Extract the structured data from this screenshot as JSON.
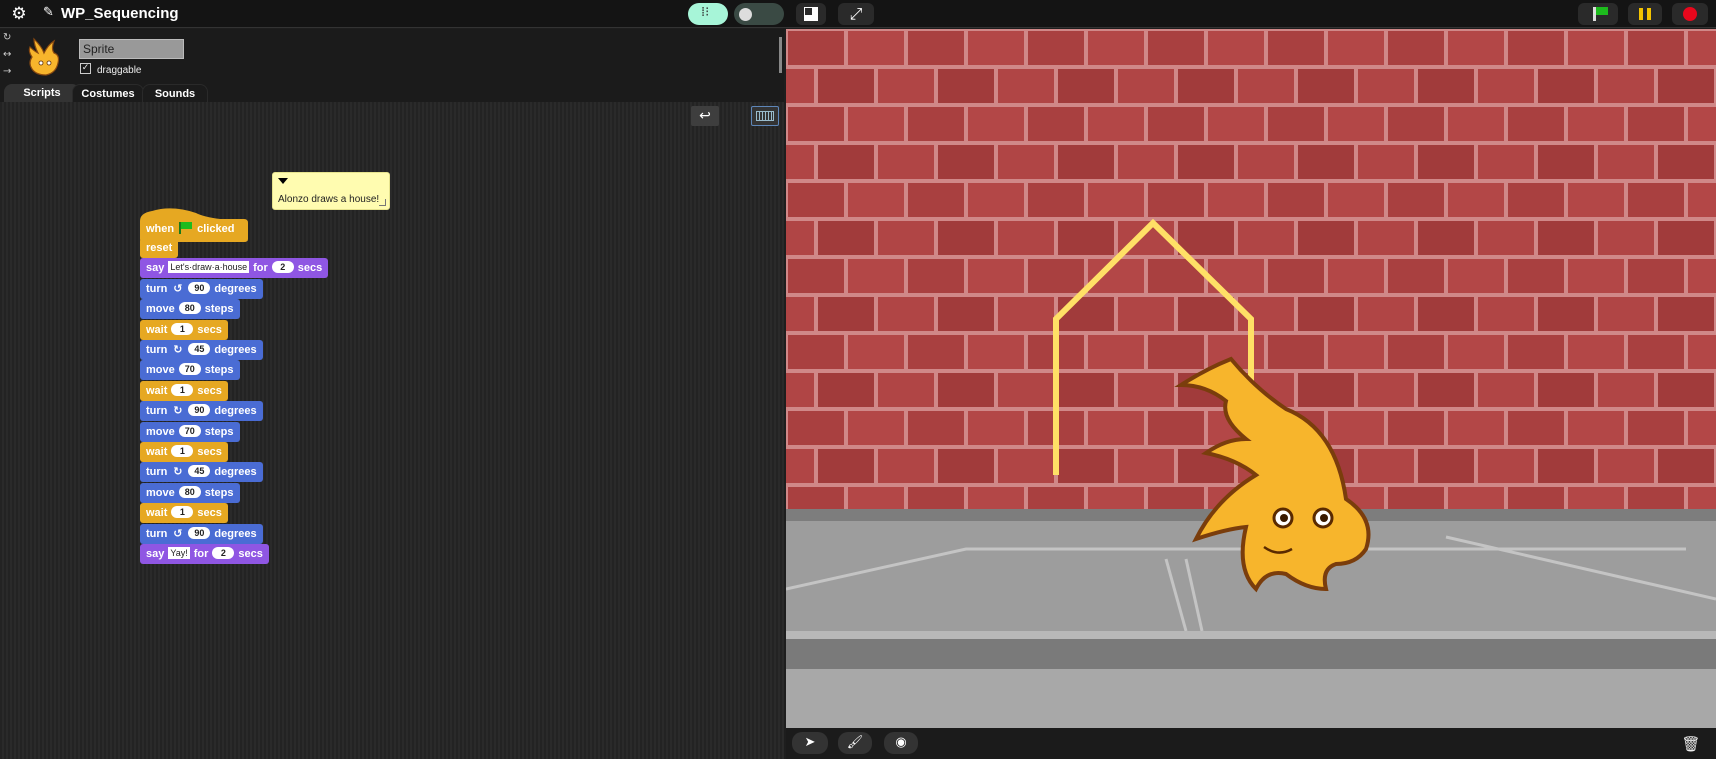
{
  "project": {
    "title": "WP_Sequencing"
  },
  "toolbar": {
    "settings_icon": "gear-icon",
    "stepping_icon": "footprints-icon",
    "fullscreen_icon": "expand-icon"
  },
  "sprite": {
    "name": "Sprite",
    "draggable_label": "draggable",
    "draggable_checked": "✓"
  },
  "tabs": [
    {
      "label": "Scripts",
      "active": true
    },
    {
      "label": "Costumes",
      "active": false
    },
    {
      "label": "Sounds",
      "active": false
    }
  ],
  "comment": {
    "text": "Alonzo draws a house!"
  },
  "script": {
    "hat": {
      "when": "when",
      "clicked": "clicked"
    },
    "blocks": [
      {
        "kind": "control",
        "label": "reset"
      },
      {
        "kind": "looks",
        "say": "say",
        "message": "Let's·draw·a·house",
        "for": "for",
        "secs_value": "2",
        "secs": "secs"
      },
      {
        "kind": "motion",
        "turn": "turn",
        "direction": "ccw",
        "value": "90",
        "unit": "degrees"
      },
      {
        "kind": "motion",
        "move": "move",
        "value": "80",
        "unit": "steps"
      },
      {
        "kind": "control",
        "wait": "wait",
        "value": "1",
        "unit": "secs"
      },
      {
        "kind": "motion",
        "turn": "turn",
        "direction": "cw",
        "value": "45",
        "unit": "degrees"
      },
      {
        "kind": "motion",
        "move": "move",
        "value": "70",
        "unit": "steps"
      },
      {
        "kind": "control",
        "wait": "wait",
        "value": "1",
        "unit": "secs"
      },
      {
        "kind": "motion",
        "turn": "turn",
        "direction": "cw",
        "value": "90",
        "unit": "degrees"
      },
      {
        "kind": "motion",
        "move": "move",
        "value": "70",
        "unit": "steps"
      },
      {
        "kind": "control",
        "wait": "wait",
        "value": "1",
        "unit": "secs"
      },
      {
        "kind": "motion",
        "turn": "turn",
        "direction": "cw",
        "value": "45",
        "unit": "degrees"
      },
      {
        "kind": "motion",
        "move": "move",
        "value": "80",
        "unit": "steps"
      },
      {
        "kind": "control",
        "wait": "wait",
        "value": "1",
        "unit": "secs"
      },
      {
        "kind": "motion",
        "turn": "turn",
        "direction": "ccw",
        "value": "90",
        "unit": "degrees"
      },
      {
        "kind": "looks",
        "say": "say",
        "message": "Yay!",
        "for": "for",
        "secs_value": "2",
        "secs": "secs"
      }
    ]
  },
  "colors": {
    "control": "#e6a822",
    "motion": "#4a6cd4",
    "looks": "#8f56e3",
    "pen": "#ffe066",
    "brick": "#b04343",
    "mortar": "#d98e8e",
    "sidewalk": "#9a9a9a"
  }
}
